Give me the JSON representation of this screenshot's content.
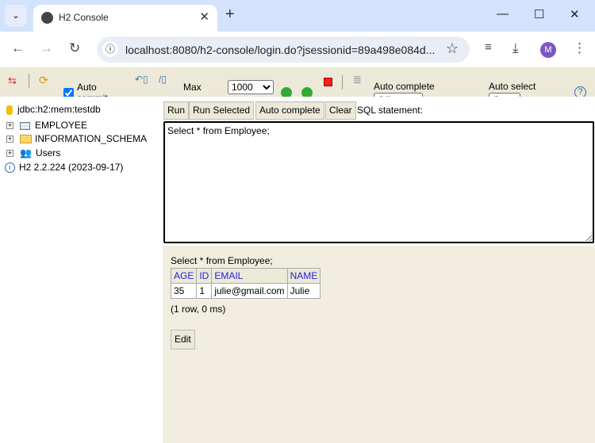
{
  "browser": {
    "tab_title": "H2 Console",
    "url": "localhost:8080/h2-console/login.do?jsessionid=89a498e084d...",
    "avatar_letter": "M"
  },
  "toolbar": {
    "auto_commit_label": "Auto commit",
    "auto_commit_checked": true,
    "max_rows_label": "Max",
    "max_rows_value": "1000",
    "auto_complete_label": "Auto complete",
    "auto_complete_value": "Off",
    "auto_select_label": "Auto select",
    "auto_select_value": "On",
    "help": "?"
  },
  "tree": {
    "connection": "jdbc:h2:mem:testdb",
    "items": [
      {
        "label": "EMPLOYEE",
        "icon": "table-icon"
      },
      {
        "label": "INFORMATION_SCHEMA",
        "icon": "folder-icon"
      },
      {
        "label": "Users",
        "icon": "users-icon"
      }
    ],
    "version": "H2 2.2.224 (2023-09-17)"
  },
  "query": {
    "run": "Run",
    "run_selected": "Run Selected",
    "auto_complete": "Auto complete",
    "clear": "Clear",
    "sql_label": "SQL statement:",
    "sql": "Select * from Employee;"
  },
  "result": {
    "statement": "Select * from Employee;",
    "columns": [
      "AGE",
      "ID",
      "EMAIL",
      "NAME"
    ],
    "rows": [
      [
        "35",
        "1",
        "julie@gmail.com",
        "Julie"
      ]
    ],
    "summary": "(1 row, 0 ms)",
    "edit": "Edit"
  }
}
